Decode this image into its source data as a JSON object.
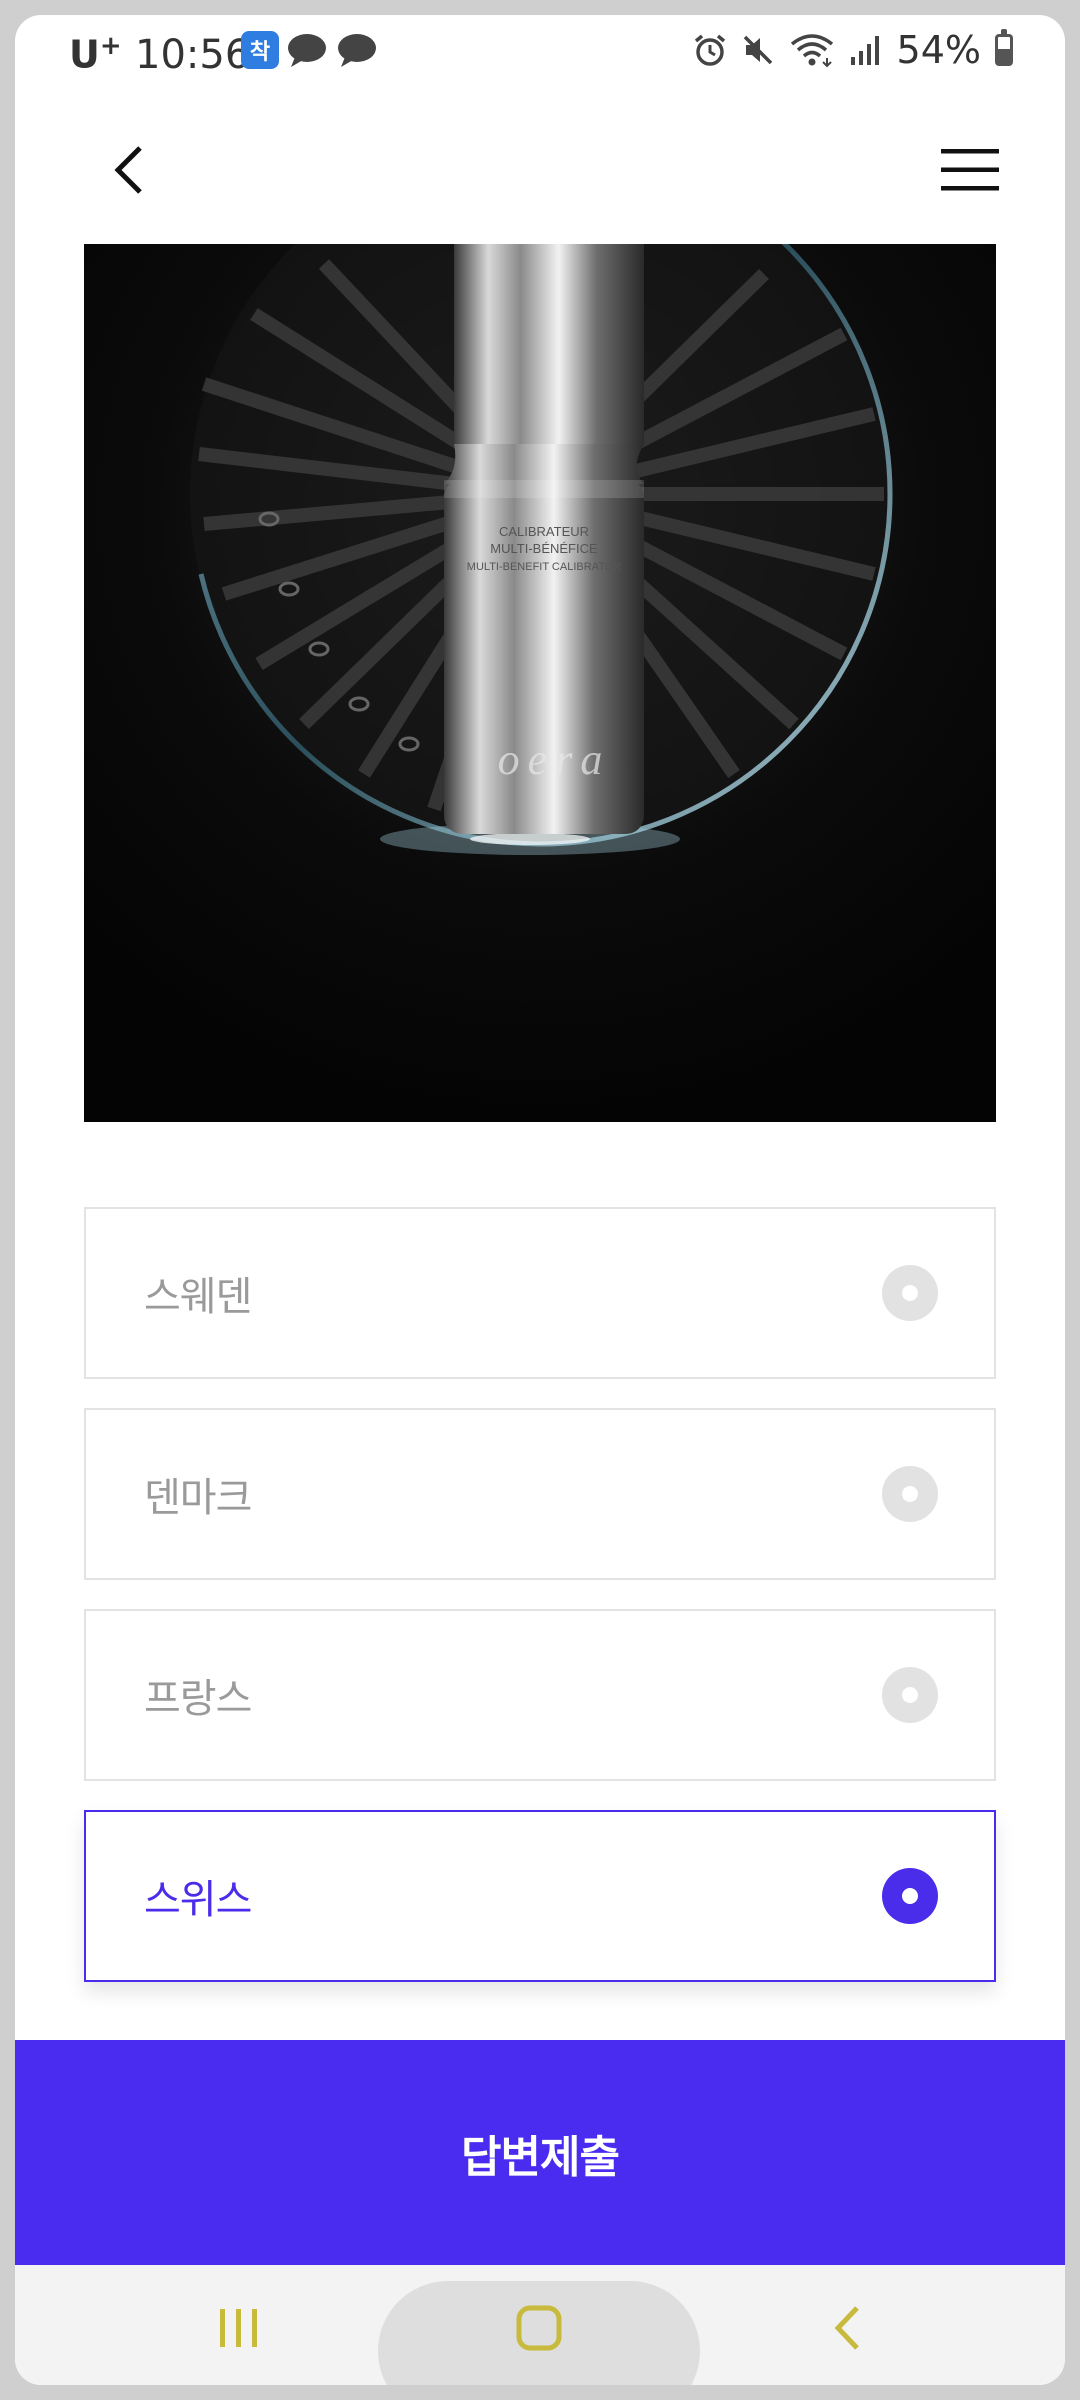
{
  "status_bar": {
    "carrier": "U",
    "carrier_plus": "+",
    "time": "10:56",
    "notification_badge": "착",
    "battery": "54%",
    "icons": [
      "alarm-icon",
      "mute-icon",
      "wifi-icon",
      "signal-icon",
      "battery-icon"
    ]
  },
  "header": {
    "back_icon": "chevron-left-icon",
    "menu_icon": "hamburger-menu-icon"
  },
  "hero": {
    "product_text_line1": "CALIBRATEUR",
    "product_text_line2": "MULTI-BÉNÉFICE",
    "product_text_line3": "MULTI-BENEFIT CALIBRATOR",
    "brand": "oera"
  },
  "quiz": {
    "options": [
      {
        "label": "스웨덴",
        "selected": false
      },
      {
        "label": "덴마크",
        "selected": false
      },
      {
        "label": "프랑스",
        "selected": false
      },
      {
        "label": "스위스",
        "selected": true
      }
    ]
  },
  "submit": {
    "label": "답변제출"
  },
  "colors": {
    "accent": "#4a2cf0",
    "unselected_text": "#9a9a9a",
    "nav_icon": "#c7ba3c"
  },
  "nav_bar": {
    "icons": [
      "recents-icon",
      "home-icon",
      "back-icon"
    ]
  }
}
